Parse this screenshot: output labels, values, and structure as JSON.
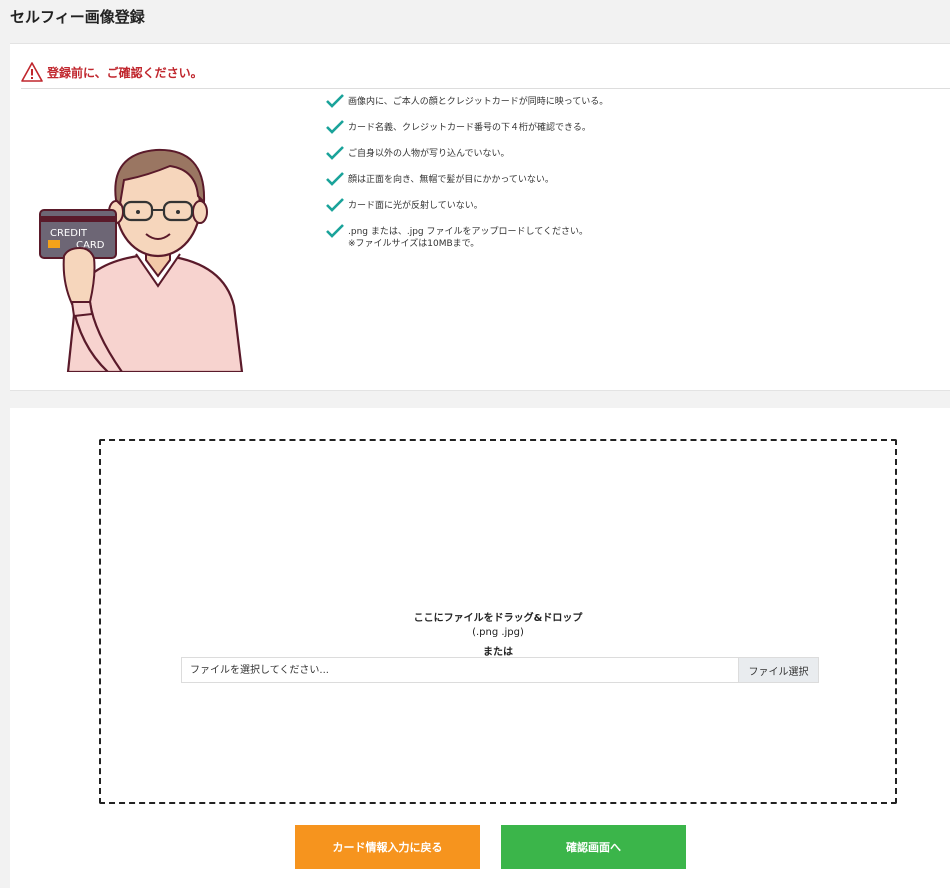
{
  "page": {
    "title": "セルフィー画像登録"
  },
  "notice": {
    "warning": "登録前に、ご確認ください。",
    "illustration_card_text_line1": "CREDIT",
    "illustration_card_text_line2": "CARD",
    "checklist": [
      "画像内に、ご本人の顔とクレジットカードが同時に映っている。",
      "カード名義、クレジットカード番号の下４桁が確認できる。",
      "ご自身以外の人物が写り込んでいない。",
      "顔は正面を向き、無帽で髪が目にかかっていない。",
      "カード面に光が反射していない。",
      ".png または、.jpg ファイルをアップロードしてください。"
    ],
    "checklist_note": "※ファイルサイズは10MBまで。"
  },
  "upload": {
    "drop_main": "ここにファイルをドラッグ&ドロップ",
    "drop_ext": "(.png .jpg)",
    "drop_or": "または",
    "input_placeholder": "ファイルを選択してください...",
    "select_button": "ファイル選択"
  },
  "actions": {
    "back_label": "カード情報入力に戻る",
    "confirm_label": "確認画面へ"
  },
  "colors": {
    "warning": "#c0262d",
    "check": "#1aa39a",
    "back_button": "#f6941e",
    "confirm_button": "#3bb54a"
  }
}
